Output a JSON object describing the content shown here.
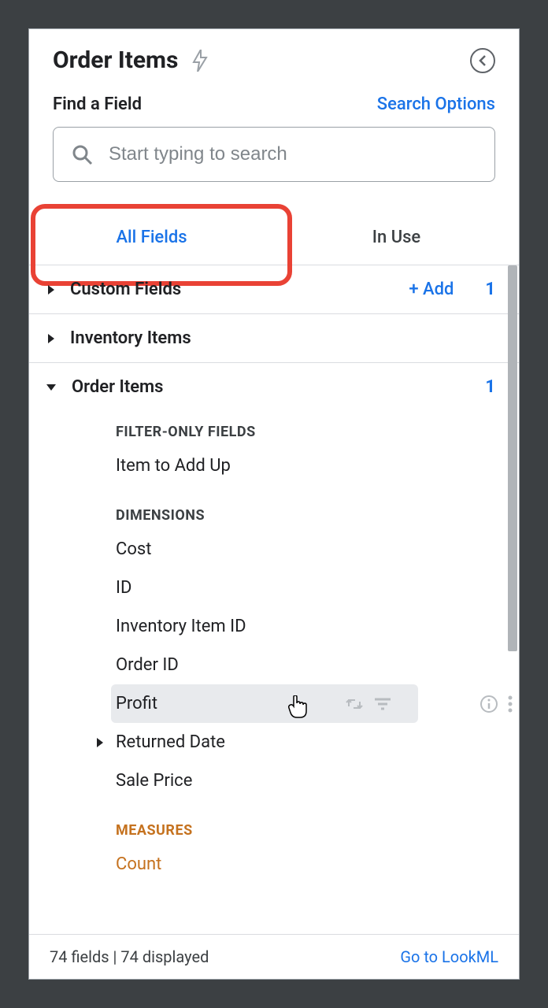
{
  "header": {
    "title": "Order Items"
  },
  "search": {
    "find_label": "Find a Field",
    "options_label": "Search Options",
    "placeholder": "Start typing to search"
  },
  "tabs": {
    "all_fields": "All Fields",
    "in_use": "In Use"
  },
  "groups": {
    "custom_fields": {
      "label": "Custom Fields",
      "add": "+  Add",
      "count": "1"
    },
    "inventory_items": {
      "label": "Inventory Items"
    },
    "order_items": {
      "label": "Order Items",
      "count": "1"
    }
  },
  "sections": {
    "filter_only": "FILTER-ONLY FIELDS",
    "dimensions": "DIMENSIONS",
    "measures": "MEASURES"
  },
  "fields": {
    "item_to_add_up": "Item to Add Up",
    "cost": "Cost",
    "id": "ID",
    "inventory_item_id": "Inventory Item ID",
    "order_id": "Order ID",
    "profit": "Profit",
    "returned_date": "Returned Date",
    "sale_price": "Sale Price",
    "count": "Count"
  },
  "footer": {
    "count_text": "74 fields | 74 displayed",
    "link": "Go to LookML"
  }
}
